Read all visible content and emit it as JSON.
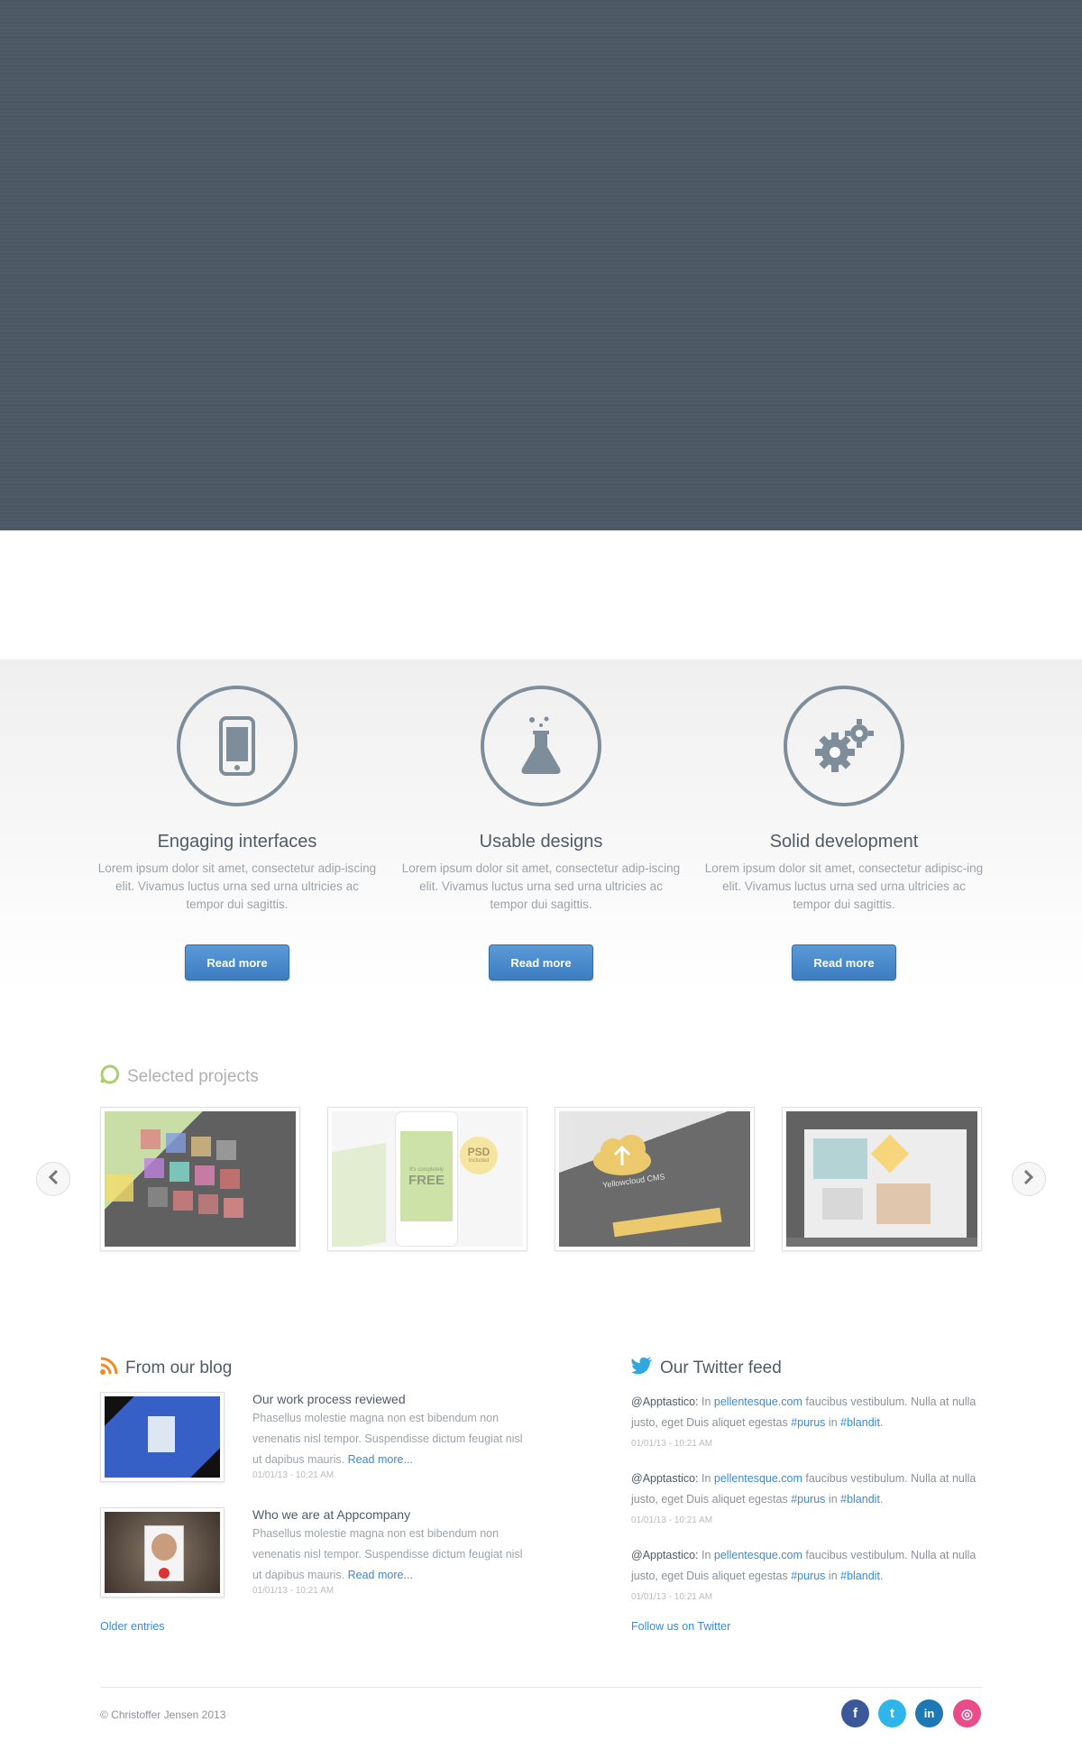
{
  "features": [
    {
      "icon": "smartphone-icon",
      "title": "Engaging interfaces",
      "text": "Lorem ipsum dolor sit amet, consectetur adip-iscing elit. Vivamus luctus urna sed urna ultricies ac tempor dui sagittis.",
      "button": "Read more"
    },
    {
      "icon": "flask-icon",
      "title": "Usable designs",
      "text": "Lorem ipsum dolor sit amet, consectetur adip-iscing elit. Vivamus luctus urna sed urna ultricies ac tempor dui sagittis.",
      "button": "Read more"
    },
    {
      "icon": "gears-icon",
      "title": "Solid development",
      "text": "Lorem ipsum dolor sit amet, consectetur adipisc-ing elit. Vivamus luctus urna sed urna ultricies ac tempor dui sagittis.",
      "button": "Read more"
    }
  ],
  "projects": {
    "title": "Selected projects",
    "items": [
      {
        "alt": "Music app on tablet"
      },
      {
        "alt": "iPhone mockup",
        "badge": "PSD",
        "badge_sub": "Included",
        "free_top": "It's completely",
        "free": "FREE"
      },
      {
        "alt": "Yellowcloud CMS",
        "brand": "Yellowcloud CMS"
      },
      {
        "alt": "App gallery on phone"
      }
    ]
  },
  "blog": {
    "title": "From our blog",
    "posts": [
      {
        "title": "Our work process reviewed",
        "text": "Phasellus molestie magna non est bibendum non venenatis nisl tempor. Suspendisse dictum feugiat nisl ut dapibus mauris.",
        "more": "Read more...",
        "date": "01/01/13 - 10:21 AM"
      },
      {
        "title": "Who we are at Appcompany",
        "text": "Phasellus molestie magna non est bibendum non venenatis nisl tempor. Suspendisse dictum feugiat nisl ut dapibus mauris.",
        "more": "Read more...",
        "date": "01/01/13 - 10:21 AM"
      }
    ],
    "older": "Older entries"
  },
  "twitter": {
    "title": "Our Twitter feed",
    "tweets": [
      {
        "handle": "@Apptastico:",
        "pre": " In ",
        "link": "pellentesque.com",
        "mid": " faucibus vestibulum. Nulla at nulla justo, eget Duis aliquet egestas ",
        "tag1": "#purus",
        "in": " in ",
        "tag2": "#blandit",
        "end": ".",
        "date": "01/01/13 - 10:21 AM"
      },
      {
        "handle": "@Apptastico:",
        "pre": " In ",
        "link": "pellentesque.com",
        "mid": " faucibus vestibulum. Nulla at nulla justo, eget Duis aliquet egestas ",
        "tag1": "#purus",
        "in": " in ",
        "tag2": "#blandit",
        "end": ".",
        "date": "01/01/13 - 10:21 AM"
      },
      {
        "handle": "@Apptastico:",
        "pre": " In ",
        "link": "pellentesque.com",
        "mid": " faucibus vestibulum. Nulla at nulla justo, eget Duis aliquet egestas ",
        "tag1": "#purus",
        "in": " in ",
        "tag2": "#blandit",
        "end": ".",
        "date": "01/01/13 - 10:21 AM"
      }
    ],
    "follow": "Follow us on Twitter"
  },
  "footer": {
    "copyright": "© Christoffer Jensen 2013",
    "social": [
      {
        "name": "facebook",
        "glyph": "f",
        "color": "#3b5998"
      },
      {
        "name": "twitter",
        "glyph": "t",
        "color": "#2fb5ea"
      },
      {
        "name": "linkedin",
        "glyph": "in",
        "color": "#1e78b3"
      },
      {
        "name": "dribbble",
        "glyph": "◎",
        "color": "#ea4c89"
      }
    ]
  },
  "colors": {
    "hero": "#4c5966",
    "accent": "#3c8ad4",
    "icon": "#7e8d9a"
  }
}
